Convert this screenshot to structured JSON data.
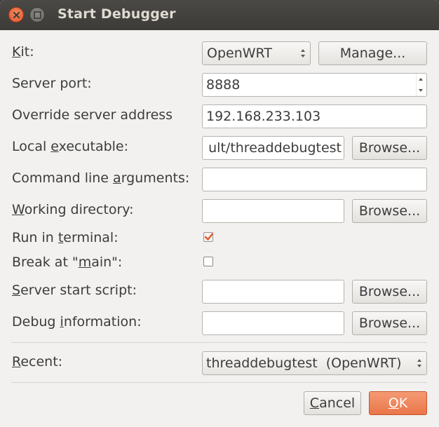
{
  "window": {
    "title": "Start Debugger"
  },
  "form": {
    "kit": {
      "label_mn": "K",
      "label_rest": "it:",
      "value": "OpenWRT",
      "manage_label": "Manage..."
    },
    "server_port": {
      "label": "Server port:",
      "value": "8888"
    },
    "override_address": {
      "label": "Override server address",
      "value": "192.168.233.103"
    },
    "local_executable": {
      "label_pre": "Local ",
      "label_mn": "e",
      "label_post": "xecutable:",
      "value": "ult/threaddebugtest",
      "browse_label": "Browse..."
    },
    "command_line_args": {
      "label_pre": "Command line ",
      "label_mn": "a",
      "label_post": "rguments:",
      "value": ""
    },
    "working_directory": {
      "label_mn": "W",
      "label_post": "orking directory:",
      "value": "",
      "browse_label": "Browse..."
    },
    "run_in_terminal": {
      "label_pre": "Run in ",
      "label_mn": "t",
      "label_post": "erminal:",
      "checked": true
    },
    "break_at_main": {
      "label_pre": "Break at \"",
      "label_mn": "m",
      "label_post": "ain\":",
      "checked": false
    },
    "server_start_script": {
      "label_mn": "S",
      "label_post": "erver start script:",
      "value": "",
      "browse_label": "Browse..."
    },
    "debug_information": {
      "label_pre": "Debug ",
      "label_mn": "i",
      "label_post": "nformation:",
      "value": "",
      "browse_label": "Browse..."
    },
    "recent": {
      "label_mn": "R",
      "label_post": "ecent:",
      "value": "threaddebugtest  (OpenWRT)"
    }
  },
  "buttons": {
    "cancel_mn": "C",
    "cancel_rest": "ancel",
    "ok_mn": "O",
    "ok_rest": "K"
  },
  "colors": {
    "titlebar": "#3c3b37",
    "accent": "#ea7649",
    "dialog_bg": "#f2f1f0"
  }
}
